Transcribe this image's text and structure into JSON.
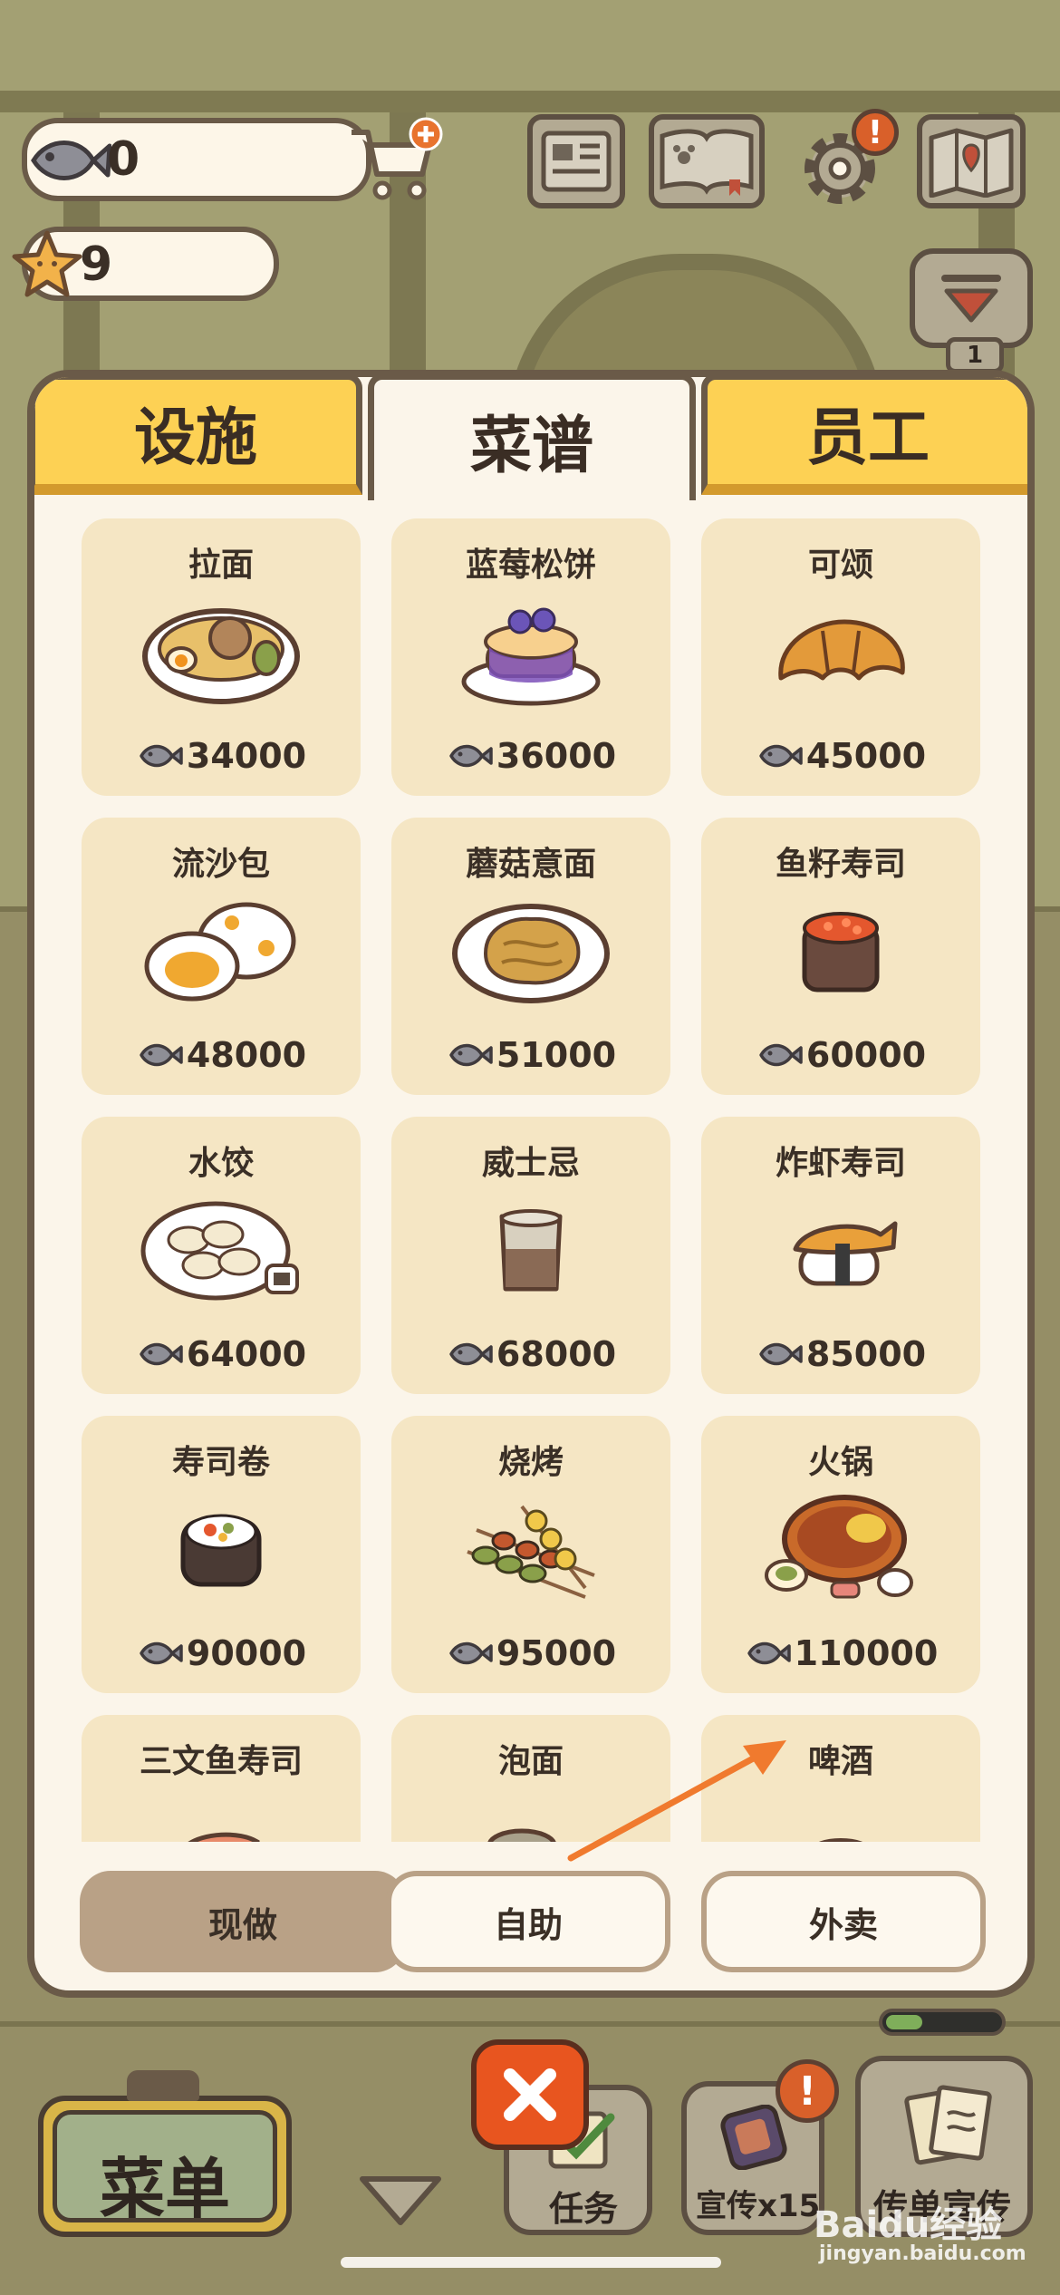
{
  "hud": {
    "fish_count": "0",
    "star_count": "9",
    "icons": [
      "fish-icon",
      "cart-plus-icon",
      "star-icon",
      "newspaper-icon",
      "pawbook-icon",
      "gear-icon",
      "map-icon",
      "collapse-icon"
    ],
    "floor_badge": "1"
  },
  "tabs": [
    {
      "label": "设施",
      "active": false
    },
    {
      "label": "菜谱",
      "active": true
    },
    {
      "label": "员工",
      "active": false
    }
  ],
  "recipes": [
    {
      "name": "拉面",
      "price": "34000",
      "icon": "ramen-icon"
    },
    {
      "name": "蓝莓松饼",
      "price": "36000",
      "icon": "pancake-icon"
    },
    {
      "name": "可颂",
      "price": "45000",
      "icon": "croissant-icon"
    },
    {
      "name": "流沙包",
      "price": "48000",
      "icon": "custard-bun-icon"
    },
    {
      "name": "蘑菇意面",
      "price": "51000",
      "icon": "mushroom-pasta-icon"
    },
    {
      "name": "鱼籽寿司",
      "price": "60000",
      "icon": "roe-sushi-icon"
    },
    {
      "name": "水饺",
      "price": "64000",
      "icon": "dumplings-icon"
    },
    {
      "name": "威士忌",
      "price": "68000",
      "icon": "whiskey-icon"
    },
    {
      "name": "炸虾寿司",
      "price": "85000",
      "icon": "shrimp-sushi-icon"
    },
    {
      "name": "寿司卷",
      "price": "90000",
      "icon": "sushi-roll-icon"
    },
    {
      "name": "烧烤",
      "price": "95000",
      "icon": "skewers-icon"
    },
    {
      "name": "火锅",
      "price": "110000",
      "icon": "hotpot-icon"
    },
    {
      "name": "三文鱼寿司",
      "price": "",
      "icon": "salmon-sushi-icon"
    },
    {
      "name": "泡面",
      "price": "",
      "icon": "instant-noodle-icon"
    },
    {
      "name": "啤酒",
      "price": "",
      "icon": "beer-icon"
    }
  ],
  "modes": [
    {
      "label": "现做",
      "active": true
    },
    {
      "label": "自助",
      "active": false
    },
    {
      "label": "外卖",
      "active": false
    }
  ],
  "bottom": {
    "menu_label": "菜单",
    "task_label": "任务",
    "promo_label": "宣传x15",
    "flyer_label": "传单宣传"
  },
  "watermark": {
    "brand": "Baidu经验",
    "url": "jingyan.baidu.com"
  },
  "colors": {
    "tab_yellow": "#fdd154",
    "card_bg": "#f5e6c4",
    "close_orange": "#e8551f",
    "arrow": "#f07a2e"
  }
}
